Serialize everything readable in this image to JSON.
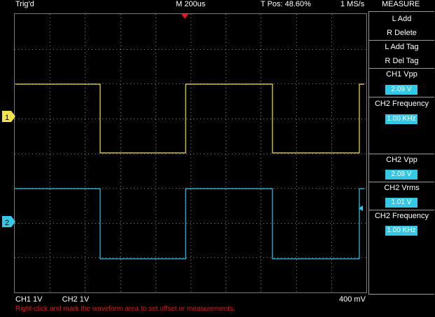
{
  "header": {
    "trigger_status": "Trig'd",
    "timebase": "M 200us",
    "t_pos": "T Pos: 48.60%",
    "sample_rate": "1 MS/s",
    "menu_title": "MEASURE"
  },
  "measure_panel": {
    "buttons": [
      {
        "line1": "L Add",
        "line2": "R Delete"
      },
      {
        "line1": "L Add Tag",
        "line2": "R Del Tag"
      }
    ],
    "readouts": [
      {
        "label": "CH1 Vpp",
        "value": "2.09 V"
      },
      {
        "label": "CH2 Frequency",
        "value": "1.00 KHz"
      },
      {
        "label": "CH2 Vpp",
        "value": "2.08 V"
      },
      {
        "label": "CH2 Vrms",
        "value": "1.01 V"
      },
      {
        "label": "CH2 Frequency",
        "value": "1.00 KHz"
      }
    ]
  },
  "footer": {
    "ch1_scale": "CH1  1V",
    "ch2_scale": "CH2  1V",
    "cursor_scale": "400 mV",
    "hint": "Right-click and mark the waveform area to set offset or measurements."
  },
  "channels": {
    "ch1": {
      "marker": "1",
      "color": "#f2e34c"
    },
    "ch2": {
      "marker": "2",
      "color": "#35c8e6"
    }
  },
  "colors": {
    "background": "#000000",
    "grid": "#808080",
    "trigger_marker": "#e01818",
    "value_box": "#35c8e6"
  }
}
